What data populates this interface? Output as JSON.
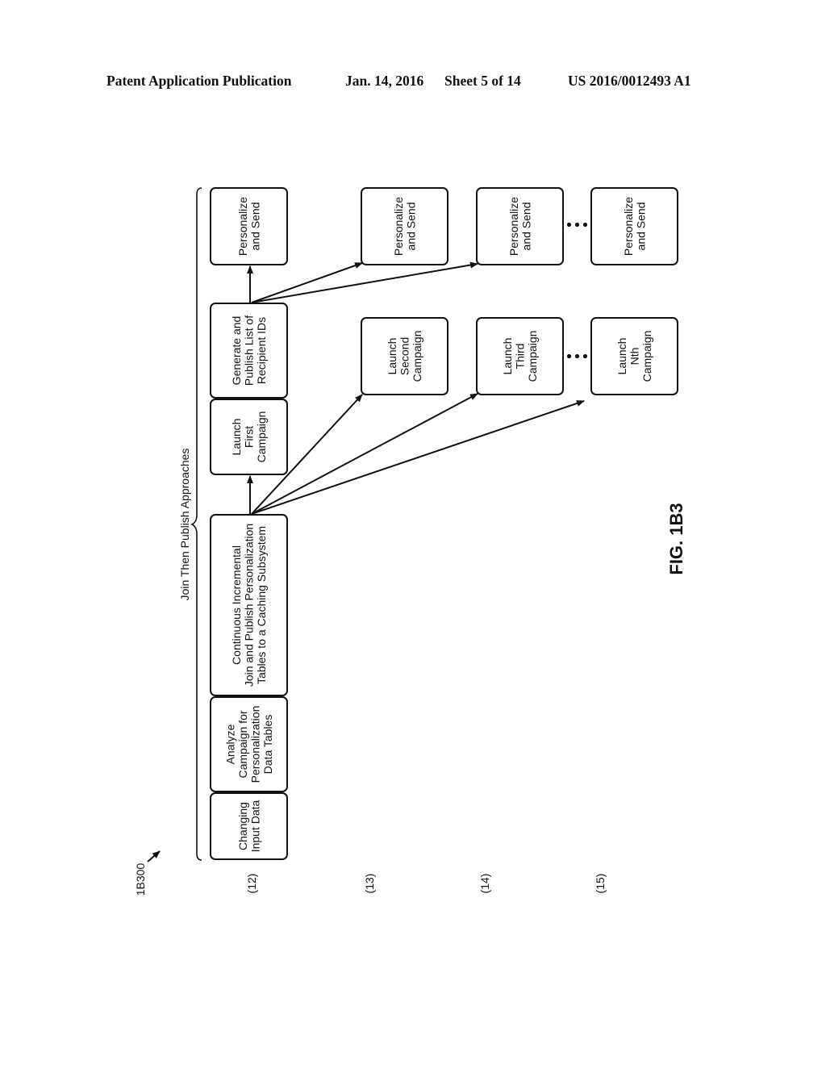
{
  "header": {
    "title": "Patent Application Publication",
    "date": "Jan. 14, 2016",
    "sheet": "Sheet 5 of 14",
    "number": "US 2016/0012493 A1"
  },
  "figure": {
    "reference": "1B300",
    "label": "FIG. 1B3",
    "brace_label": "Join Then Publish Approaches"
  },
  "rows": [
    {
      "id": "row-12",
      "label": "(12)"
    },
    {
      "id": "row-13",
      "label": "(13)"
    },
    {
      "id": "row-14",
      "label": "(14)"
    },
    {
      "id": "row-15",
      "label": "(15)"
    }
  ],
  "boxes": [
    {
      "id": "changing-input-data",
      "lines": [
        "Changing",
        "Input Data"
      ]
    },
    {
      "id": "analyze-campaign",
      "lines": [
        "Analyze",
        "Campaign for",
        "Personalization",
        "Data Tables"
      ]
    },
    {
      "id": "continuous-join-publish",
      "lines": [
        "Continuous Incremental",
        "Join and Publish Personalization",
        "Tables to a Caching Subsystem"
      ]
    },
    {
      "id": "launch-first-campaign",
      "lines": [
        "Launch",
        "First",
        "Campaign"
      ]
    },
    {
      "id": "generate-publish-recipients",
      "lines": [
        "Generate and",
        "Publish List of",
        "Recipient IDs"
      ]
    },
    {
      "id": "personalize-send-1",
      "lines": [
        "Personalize",
        "and Send"
      ]
    },
    {
      "id": "launch-second-campaign",
      "lines": [
        "Launch",
        "Second",
        "Campaign"
      ]
    },
    {
      "id": "personalize-send-2",
      "lines": [
        "Personalize",
        "and Send"
      ]
    },
    {
      "id": "launch-third-campaign",
      "lines": [
        "Launch",
        "Third",
        "Campaign"
      ]
    },
    {
      "id": "personalize-send-3",
      "lines": [
        "Personalize",
        "and Send"
      ]
    },
    {
      "id": "launch-nth-campaign",
      "lines": [
        "Launch",
        "Nth",
        "Campaign"
      ]
    },
    {
      "id": "personalize-send-n",
      "lines": [
        "Personalize",
        "and Send"
      ]
    }
  ],
  "connections": [
    {
      "from": "continuous-join-publish",
      "to": "launch-first-campaign"
    },
    {
      "from": "continuous-join-publish",
      "to": "launch-second-campaign"
    },
    {
      "from": "continuous-join-publish",
      "to": "launch-third-campaign"
    },
    {
      "from": "continuous-join-publish",
      "to": "launch-nth-campaign"
    },
    {
      "from": "generate-publish-recipients",
      "to": "personalize-send-1"
    },
    {
      "from": "generate-publish-recipients",
      "to": "personalize-send-2"
    },
    {
      "from": "generate-publish-recipients",
      "to": "personalize-send-3"
    }
  ],
  "ellipses": [
    {
      "between": [
        "launch-third-campaign",
        "launch-nth-campaign"
      ]
    },
    {
      "between": [
        "personalize-send-3",
        "personalize-send-n"
      ]
    }
  ]
}
